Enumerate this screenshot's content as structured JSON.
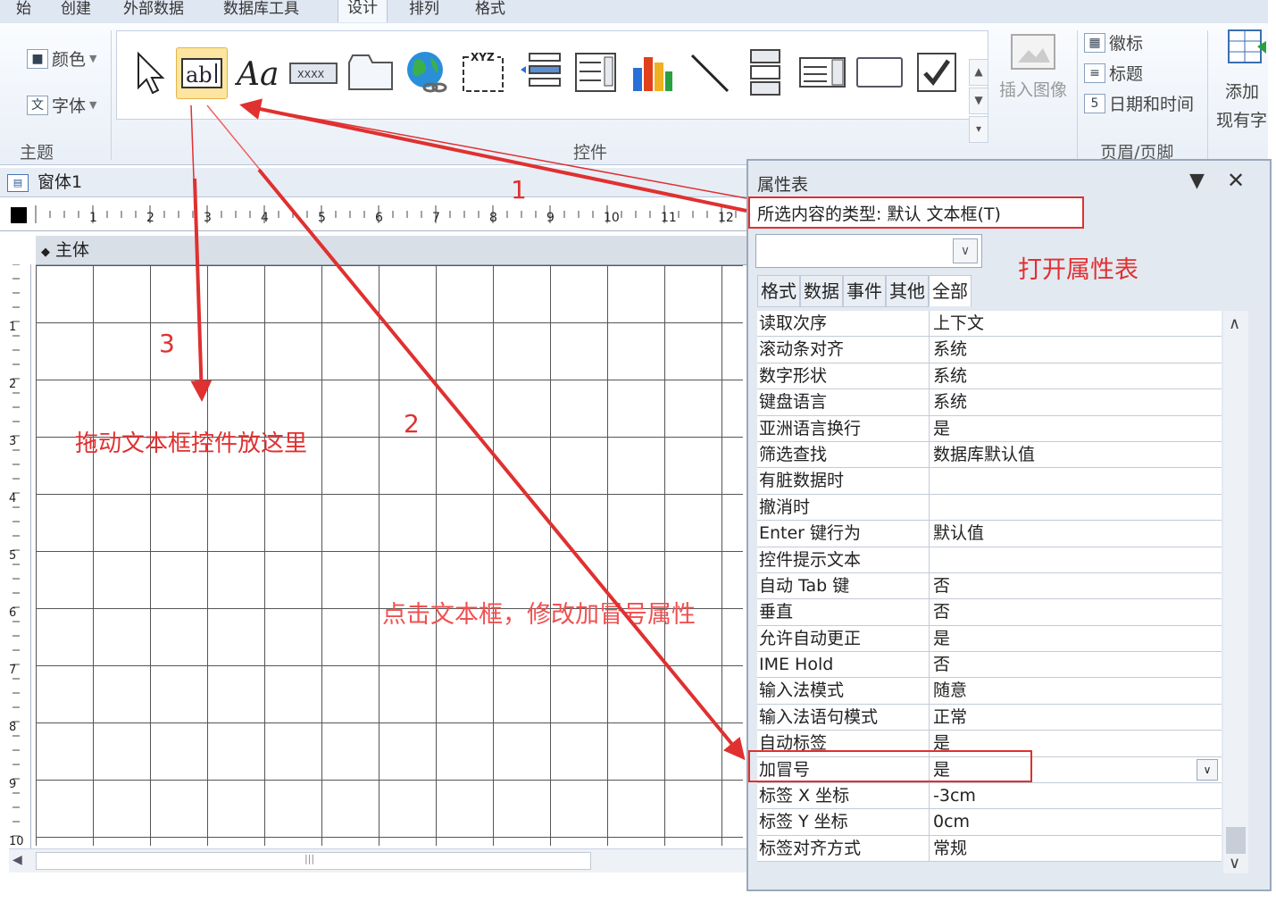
{
  "ribbon_tabs": [
    "始",
    "创建",
    "外部数据",
    "数据库工具",
    "设计",
    "排列",
    "格式"
  ],
  "active_tab": "设计",
  "theme_group": {
    "label": "主题",
    "colors": "颜色",
    "fonts": "字体"
  },
  "controls_group": {
    "label": "控件"
  },
  "insert_image": "插入图像",
  "header_footer_group": {
    "label": "页眉/页脚",
    "items": [
      "徽标",
      "标题",
      "日期和时间"
    ]
  },
  "add_existing": [
    "添加",
    "现有字"
  ],
  "form": {
    "title": "窗体1",
    "section": "主体",
    "ruler_marks": [
      "1",
      "2",
      "3",
      "4",
      "5",
      "6",
      "7",
      "8",
      "9",
      "10",
      "11",
      "12"
    ],
    "vruler_marks": [
      "1",
      "2",
      "3",
      "4",
      "5",
      "6",
      "7",
      "8",
      "9",
      "10"
    ]
  },
  "property_sheet": {
    "title": "属性表",
    "selection_type": "所选内容的类型: 默认 文本框(T)",
    "tabs": [
      "格式",
      "数据",
      "事件",
      "其他",
      "全部"
    ],
    "active_tab": "全部",
    "rows": [
      {
        "name": "读取次序",
        "value": "上下文"
      },
      {
        "name": "滚动条对齐",
        "value": "系统"
      },
      {
        "name": "数字形状",
        "value": "系统"
      },
      {
        "name": "键盘语言",
        "value": "系统"
      },
      {
        "name": "亚洲语言换行",
        "value": "是"
      },
      {
        "name": "筛选查找",
        "value": "数据库默认值"
      },
      {
        "name": "有脏数据时",
        "value": ""
      },
      {
        "name": "撤消时",
        "value": ""
      },
      {
        "name": "Enter 键行为",
        "value": "默认值"
      },
      {
        "name": "控件提示文本",
        "value": ""
      },
      {
        "name": "自动 Tab 键",
        "value": "否"
      },
      {
        "name": "垂直",
        "value": "否"
      },
      {
        "name": "允许自动更正",
        "value": "是"
      },
      {
        "name": "IME Hold",
        "value": "否"
      },
      {
        "name": "输入法模式",
        "value": "随意"
      },
      {
        "name": "输入法语句模式",
        "value": "正常"
      },
      {
        "name": "自动标签",
        "value": "是"
      },
      {
        "name": "加冒号",
        "value": "是"
      },
      {
        "name": "标签 X 坐标",
        "value": "-3cm"
      },
      {
        "name": "标签 Y 坐标",
        "value": "0cm"
      },
      {
        "name": "标签对齐方式",
        "value": "常规"
      }
    ]
  },
  "annotations": {
    "step1": "1",
    "step2": "2",
    "step3": "3",
    "open_sheet": "打开属性表",
    "drag_here": "拖动文本框控件放这里",
    "click_modify": "点击文本框，修改加冒号属性"
  }
}
